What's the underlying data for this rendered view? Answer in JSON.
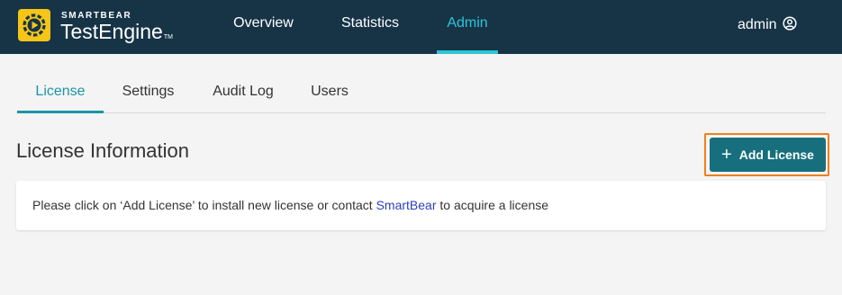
{
  "header": {
    "brand_small": "SMARTBEAR",
    "brand_name": "TestEngine",
    "brand_tm": "TM",
    "nav": [
      {
        "label": "Overview"
      },
      {
        "label": "Statistics"
      },
      {
        "label": "Admin",
        "active": true
      }
    ],
    "user": {
      "name": "admin",
      "icon": "user-circle-icon"
    }
  },
  "tabs": [
    {
      "label": "License",
      "active": true
    },
    {
      "label": "Settings"
    },
    {
      "label": "Audit Log"
    },
    {
      "label": "Users"
    }
  ],
  "main": {
    "title": "License Information",
    "add_button": {
      "icon": "plus-icon",
      "label": "Add License"
    },
    "message": {
      "before": "Please click on ‘Add License’ to install new license or contact ",
      "link": "SmartBear",
      "after": " to acquire a license"
    }
  },
  "colors": {
    "header_bg": "#173447",
    "accent": "#2ec4d6",
    "tab_accent": "#1a95a6",
    "button_bg": "#176f7e",
    "highlight": "#f07f1a",
    "link": "#2b3fb8",
    "logo": "#f5c518"
  }
}
